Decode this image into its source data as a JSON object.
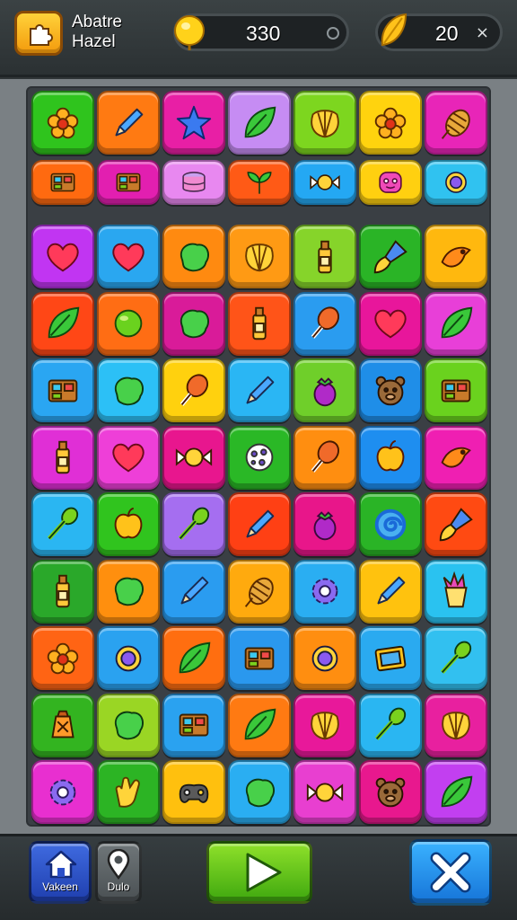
{
  "header": {
    "title_line1": "Abatre",
    "title_line2": "Hazel",
    "coins_value": "330",
    "gems_value": "20",
    "gems_suffix": "×"
  },
  "footer": {
    "home_label": "Vakeen",
    "map_label": "Dulo"
  },
  "board": {
    "rows": [
      [
        {
          "color": "#2fc41d",
          "icon": "flower-icon"
        },
        {
          "color": "#ff7a12",
          "icon": "pencil-icon"
        },
        {
          "color": "#e81fa5",
          "icon": "star-icon"
        },
        {
          "color": "#c68cf3",
          "icon": "leaf-icon"
        },
        {
          "color": "#7dd61f",
          "icon": "shell-icon"
        },
        {
          "color": "#ffd30e",
          "icon": "flower-icon"
        },
        {
          "color": "#e825b8",
          "icon": "pinecone-icon"
        }
      ],
      [
        {
          "color": "#ff6a10",
          "icon": "box-icon",
          "short": true
        },
        {
          "color": "#e21fb0",
          "icon": "box-icon",
          "short": true
        },
        {
          "color": "#e888f0",
          "icon": "cake-icon",
          "short": true
        },
        {
          "color": "#ff5a16",
          "icon": "sprout-icon",
          "short": true
        },
        {
          "color": "#24a8f3",
          "icon": "candy-icon",
          "short": true
        },
        {
          "color": "#ffd010",
          "icon": "face-icon",
          "short": true
        },
        {
          "color": "#30c2f0",
          "icon": "ring-icon",
          "short": true
        }
      ],
      [
        {
          "color": "#c135f2",
          "icon": "heart-icon"
        },
        {
          "color": "#2aa7f0",
          "icon": "heart-icon"
        },
        {
          "color": "#ff8a10",
          "icon": "blob-icon"
        },
        {
          "color": "#ff9a14",
          "icon": "shell-icon"
        },
        {
          "color": "#86d42a",
          "icon": "bottle-icon"
        },
        {
          "color": "#2ab426",
          "icon": "brush-icon"
        },
        {
          "color": "#ffb80e",
          "icon": "bird-icon"
        }
      ],
      [
        {
          "color": "#ff4716",
          "icon": "leaf-icon"
        },
        {
          "color": "#ff6d14",
          "icon": "ball-icon"
        },
        {
          "color": "#d91b99",
          "icon": "blob-icon"
        },
        {
          "color": "#ff5418",
          "icon": "bottle-icon"
        },
        {
          "color": "#2a9cf0",
          "icon": "drumstick-icon"
        },
        {
          "color": "#e8169b",
          "icon": "heart-icon"
        },
        {
          "color": "#e83fd8",
          "icon": "leaf-icon"
        }
      ],
      [
        {
          "color": "#2aa6f2",
          "icon": "box-icon"
        },
        {
          "color": "#2cc0f6",
          "icon": "blob-icon"
        },
        {
          "color": "#ffd10e",
          "icon": "drumstick-icon"
        },
        {
          "color": "#2ab6f4",
          "icon": "pencil-icon"
        },
        {
          "color": "#6fcf2a",
          "icon": "berry-icon"
        },
        {
          "color": "#1f8ee8",
          "icon": "bear-icon"
        },
        {
          "color": "#6ad21e",
          "icon": "box-icon"
        }
      ],
      [
        {
          "color": "#e02fd6",
          "icon": "bottle-icon"
        },
        {
          "color": "#ee3fd8",
          "icon": "heart-icon"
        },
        {
          "color": "#e8168e",
          "icon": "candy-icon"
        },
        {
          "color": "#2ab826",
          "icon": "dots-icon"
        },
        {
          "color": "#ff8e10",
          "icon": "drumstick-icon"
        },
        {
          "color": "#1e8ef0",
          "icon": "apple-icon"
        },
        {
          "color": "#ef1fb2",
          "icon": "bird-icon"
        }
      ],
      [
        {
          "color": "#2ab6f2",
          "icon": "spoon-icon"
        },
        {
          "color": "#30c41e",
          "icon": "apple-icon"
        },
        {
          "color": "#a56ef0",
          "icon": "spoon-icon"
        },
        {
          "color": "#ff4014",
          "icon": "pencil-icon"
        },
        {
          "color": "#e8168a",
          "icon": "berry-icon"
        },
        {
          "color": "#2ab426",
          "icon": "swirl-icon"
        },
        {
          "color": "#ff4a12",
          "icon": "brush-icon"
        }
      ],
      [
        {
          "color": "#2aa82a",
          "icon": "bottle-icon"
        },
        {
          "color": "#ff8f0e",
          "icon": "blob-icon"
        },
        {
          "color": "#2a9cf0",
          "icon": "pencil-icon"
        },
        {
          "color": "#ffaa0e",
          "icon": "pinecone-icon"
        },
        {
          "color": "#2aaef2",
          "icon": "gear-icon"
        },
        {
          "color": "#ffc20e",
          "icon": "pencil-icon"
        },
        {
          "color": "#2ac2f0",
          "icon": "cup-icon"
        }
      ],
      [
        {
          "color": "#ff6414",
          "icon": "flower-icon"
        },
        {
          "color": "#2aa2f0",
          "icon": "ring-icon"
        },
        {
          "color": "#ff6e10",
          "icon": "leaf-icon"
        },
        {
          "color": "#2a98ee",
          "icon": "box-icon"
        },
        {
          "color": "#ff8e10",
          "icon": "ring-icon"
        },
        {
          "color": "#2aaaf0",
          "icon": "frame-icon"
        },
        {
          "color": "#32c0f0",
          "icon": "spoon-icon"
        }
      ],
      [
        {
          "color": "#33b420",
          "icon": "lantern-icon"
        },
        {
          "color": "#9ad624",
          "icon": "blob-icon"
        },
        {
          "color": "#2aa2f0",
          "icon": "box-icon"
        },
        {
          "color": "#ff7a12",
          "icon": "leaf-icon"
        },
        {
          "color": "#e8189a",
          "icon": "shell-icon"
        },
        {
          "color": "#2ab6f2",
          "icon": "spoon-icon"
        },
        {
          "color": "#e8209f",
          "icon": "shell-icon"
        }
      ],
      [
        {
          "color": "#e82fd0",
          "icon": "gear-icon"
        },
        {
          "color": "#2cb424",
          "icon": "hand-icon"
        },
        {
          "color": "#ffc00e",
          "icon": "gamepad-icon"
        },
        {
          "color": "#2aaef2",
          "icon": "blob-icon"
        },
        {
          "color": "#e83fd0",
          "icon": "candy-icon"
        },
        {
          "color": "#e8188e",
          "icon": "bear-icon"
        },
        {
          "color": "#c23ff0",
          "icon": "leaf-icon"
        }
      ]
    ]
  }
}
